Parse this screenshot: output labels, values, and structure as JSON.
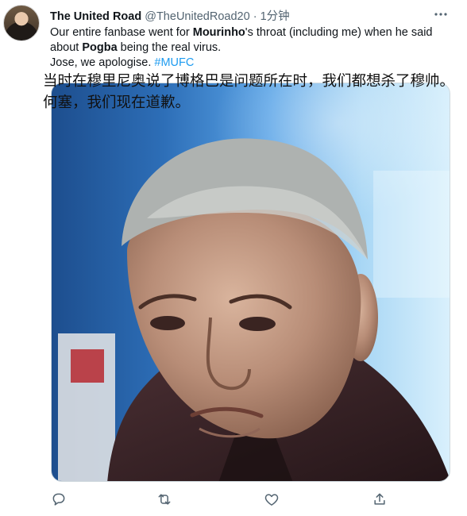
{
  "tweet": {
    "display_name": "The United Road",
    "handle": "@TheUnitedRoad20",
    "separator": "·",
    "time": "1分钟",
    "text_part1": "Our entire fanbase went for ",
    "bold1": "Mourinho",
    "text_part2": "'s throat (including me) when he said about ",
    "bold2": "Pogba",
    "text_part3": " being the real virus.",
    "text_line3": "Jose, we apologise. ",
    "hashtag": "#MUFC",
    "caption": "当时在穆里尼奥说了博格巴是问题所在时，我们都想杀了穆帅。何塞，我们现在道歉。"
  },
  "icons": {
    "more": "more-icon",
    "reply": "reply-icon",
    "retweet": "retweet-icon",
    "like": "like-icon",
    "share": "share-icon"
  },
  "colors": {
    "accent": "#1d9bf0",
    "muted": "#536471",
    "text": "#0f1419"
  }
}
